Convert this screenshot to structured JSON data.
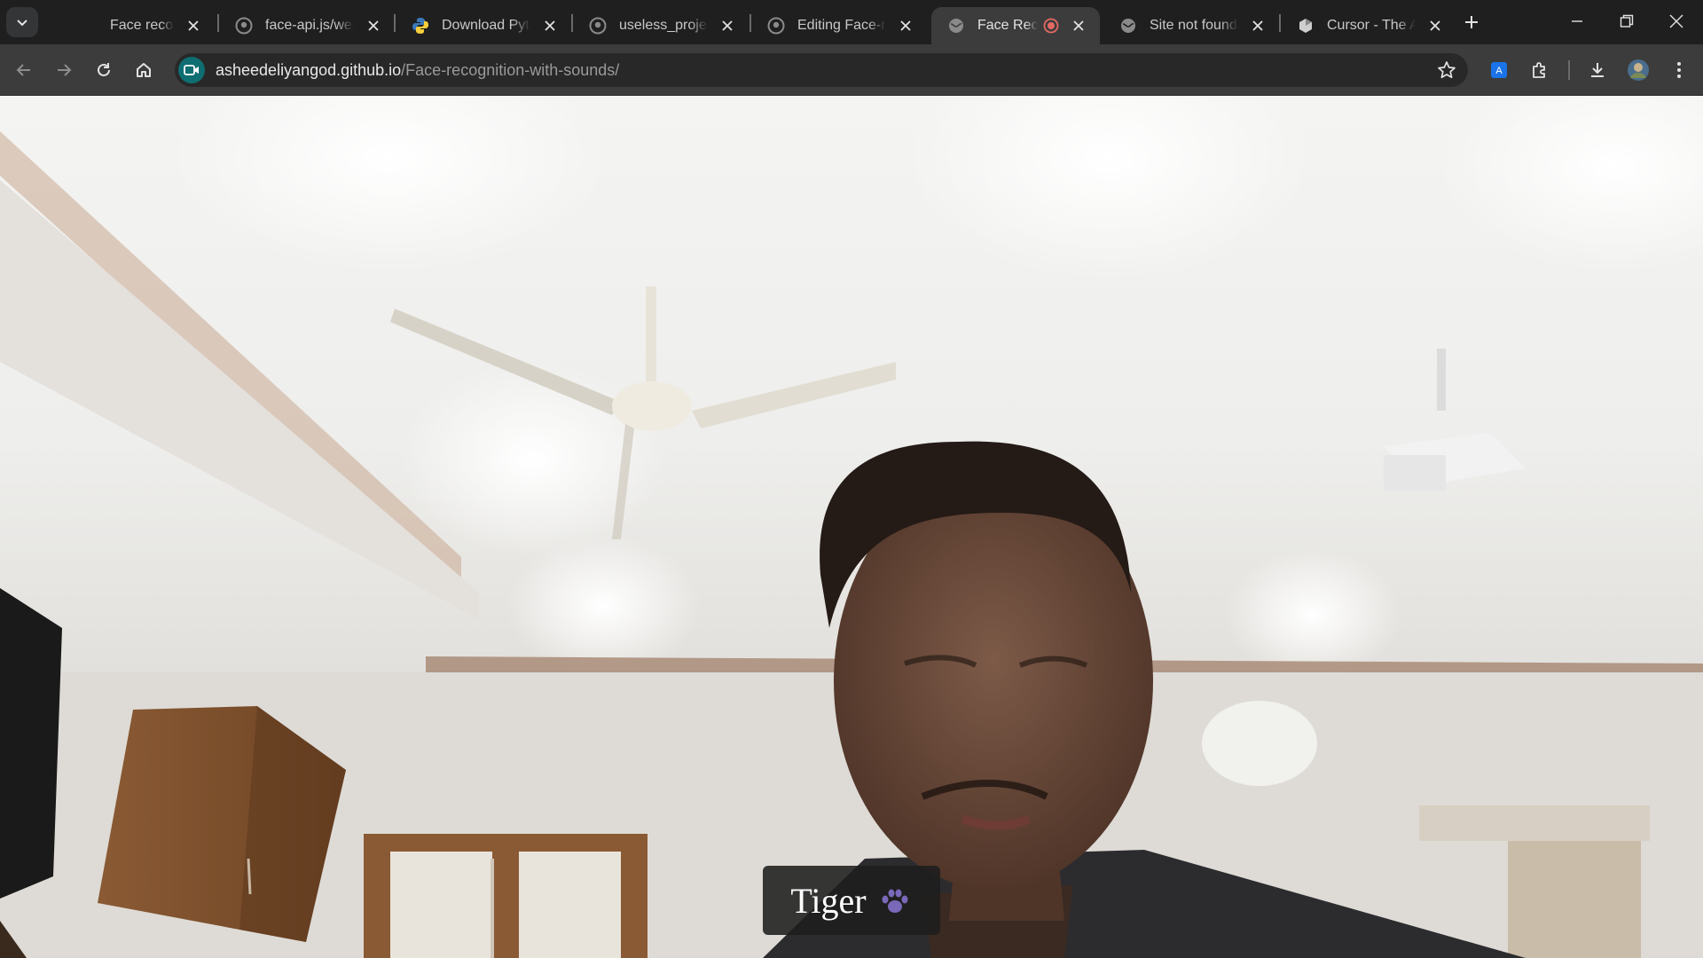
{
  "browser": {
    "tabs": [
      {
        "title": "Face recognition",
        "icon": "blank-icon",
        "active": false
      },
      {
        "title": "face-api.js/weigh",
        "icon": "github-icon",
        "active": false
      },
      {
        "title": "Download Pytho",
        "icon": "python-icon",
        "active": false
      },
      {
        "title": "useless_project_t",
        "icon": "github-icon",
        "active": false
      },
      {
        "title": "Editing Face-reco",
        "icon": "github-icon",
        "active": false
      },
      {
        "title": "Face Recogni",
        "icon": "globe-icon",
        "active": true,
        "recording": true
      },
      {
        "title": "Site not found · G",
        "icon": "globe-icon",
        "active": false
      },
      {
        "title": "Cursor - The AI C",
        "icon": "cursor-icon",
        "active": false
      }
    ],
    "address": {
      "host": "asheedeliyangod.github.io",
      "path": "/Face-recognition-with-sounds/"
    },
    "colors": {
      "tabstrip": "#1f1f1f",
      "toolbar": "#3c3c3c",
      "omnibox": "#282828",
      "site_badge": "#0e6e72",
      "recording": "#e46962"
    }
  },
  "page": {
    "detection_label": "Tiger",
    "label_icon": "paw-icon"
  }
}
